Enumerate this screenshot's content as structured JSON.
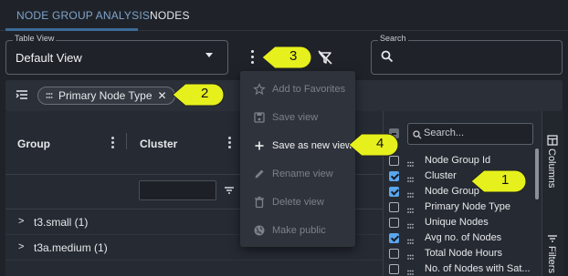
{
  "tabs": [
    {
      "label": "NODE GROUP ANALYSIS",
      "active": true
    },
    {
      "label": "NODES",
      "active": false
    }
  ],
  "table_view": {
    "label": "Table View",
    "value": "Default View"
  },
  "search": {
    "label": "Search",
    "value": ""
  },
  "chips": [
    {
      "label": "Primary Node Type"
    }
  ],
  "grid": {
    "headers": [
      "Group",
      "Cluster"
    ],
    "rows": [
      {
        "label": "t3.small (1)"
      },
      {
        "label": "t3a.medium (1)"
      }
    ]
  },
  "columns_panel": {
    "search_placeholder": "Search...",
    "side_tabs": [
      "Columns",
      "Filters"
    ],
    "items": [
      {
        "label": "Node Group Id",
        "checked": false
      },
      {
        "label": "Cluster",
        "checked": true
      },
      {
        "label": "Node Group",
        "checked": true
      },
      {
        "label": "Primary Node Type",
        "checked": false
      },
      {
        "label": "Unique Nodes",
        "checked": false
      },
      {
        "label": "Avg no. of Nodes",
        "checked": true
      },
      {
        "label": "Total Node Hours",
        "checked": false
      },
      {
        "label": "No. of Nodes with Sat...",
        "checked": false
      }
    ]
  },
  "view_menu": {
    "items": [
      {
        "label": "Add to Favorites",
        "icon": "star-icon",
        "enabled": false
      },
      {
        "label": "Save view",
        "icon": "floppy-icon",
        "enabled": false
      },
      {
        "label": "Save as new view",
        "icon": "plus-icon",
        "enabled": true
      },
      {
        "label": "Rename view",
        "icon": "pencil-icon",
        "enabled": false
      },
      {
        "label": "Delete view",
        "icon": "trash-icon",
        "enabled": false
      },
      {
        "label": "Make public",
        "icon": "globe-icon",
        "enabled": false
      }
    ]
  },
  "callouts": [
    "1",
    "2",
    "3",
    "4"
  ],
  "colors": {
    "background": "#1f2329",
    "accent": "#5aa6ee",
    "callout": "#e6f01c",
    "menu": "#2f343c"
  }
}
